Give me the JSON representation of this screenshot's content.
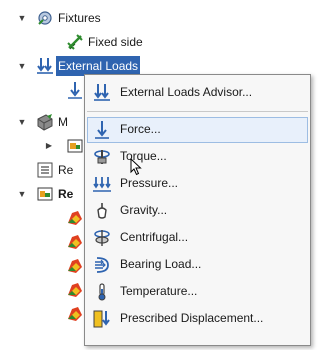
{
  "tree": {
    "fixtures_label": "Fixtures",
    "fixed_side_label": "Fixed side",
    "external_loads_label": "External Loads",
    "collapsed_m_label": "M",
    "collapsed_re1_label": "Re",
    "collapsed_re2_label": "Re"
  },
  "menu": {
    "advisor": "External Loads Advisor...",
    "force": "Force...",
    "torque": "Torque...",
    "pressure": "Pressure...",
    "gravity": "Gravity...",
    "centrifugal": "Centrifugal...",
    "bearing_load": "Bearing Load...",
    "temperature": "Temperature...",
    "prescribed_displacement": "Prescribed Displacement..."
  },
  "colors": {
    "selection": "#2f64b0",
    "hover_border": "#9dbde3",
    "hover_fill": "#e8f0fb",
    "menu_bg": "#f7f7f7"
  }
}
